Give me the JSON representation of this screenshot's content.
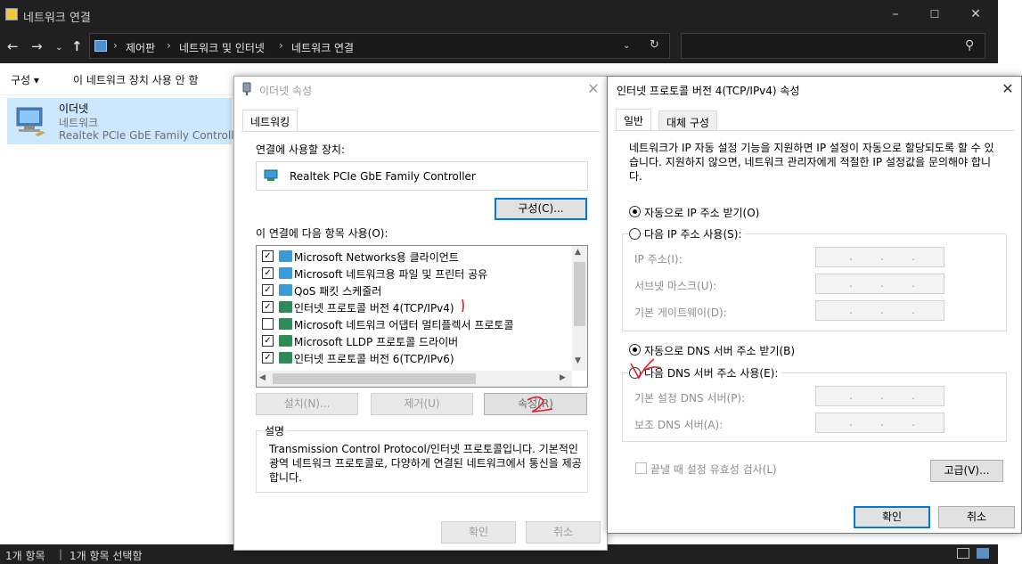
{
  "explorer": {
    "title": "네트워크 연결",
    "breadcrumbs": [
      "제어판",
      "네트워크 및 인터넷",
      "네트워크 연결"
    ],
    "commands": [
      "구성 ▾",
      "이 네트워크 장치 사용 안 함"
    ],
    "item": {
      "name": "이더넷",
      "type": "네트워크",
      "device": "Realtek PCIe GbE Family Controller"
    },
    "status": {
      "count": "1개 항목",
      "selected": "1개 항목 선택함"
    }
  },
  "ethernet_dialog": {
    "title": "이더넷 속성",
    "tab": "네트워킹",
    "connect_using_label": "연결에 사용할 장치:",
    "adapter": "Realtek PCIe GbE Family Controller",
    "configure_button": "구성(C)...",
    "items_label": "이 연결에 다음 항목 사용(O):",
    "items": [
      {
        "label": "Microsoft Networks용 클라이언트",
        "checked": true
      },
      {
        "label": "Microsoft 네트워크용 파일 및 프린터 공유",
        "checked": true
      },
      {
        "label": "QoS 패킷 스케줄러",
        "checked": true
      },
      {
        "label": "인터넷 프로토콜 버전 4(TCP/IPv4)",
        "checked": true
      },
      {
        "label": "Microsoft 네트워크 어댑터 멀티플렉서 프로토콜",
        "checked": false
      },
      {
        "label": "Microsoft LLDP 프로토콜 드라이버",
        "checked": true
      },
      {
        "label": "인터넷 프로토콜 버전 6(TCP/IPv6)",
        "checked": true
      }
    ],
    "install_button": "설치(N)...",
    "remove_button": "제거(U)",
    "properties_button": "속성(R)",
    "description_label": "설명",
    "description": "Transmission Control Protocol/인터넷 프로토콜입니다. 기본적인 광역 네트워크 프로토콜로, 다양하게 연결된 네트워크에서 통신을 제공합니다.",
    "ok_button": "확인",
    "cancel_button": "취소"
  },
  "ipv4_dialog": {
    "title": "인터넷 프로토콜 버전 4(TCP/IPv4) 속성",
    "tabs": [
      "일반",
      "대체 구성"
    ],
    "intro": "네트워크가 IP 자동 설정 기능을 지원하면 IP 설정이 자동으로 할당되도록 할 수 있습니다. 지원하지 않으면, 네트워크 관리자에게 적절한 IP 설정값을 문의해야 합니다.",
    "auto_ip": "자동으로 IP 주소 받기(O)",
    "manual_ip": "다음 IP 주소 사용(S):",
    "ip_address_label": "IP 주소(I):",
    "subnet_label": "서브넷 마스크(U):",
    "gateway_label": "기본 게이트웨이(D):",
    "auto_dns": "자동으로 DNS 서버 주소 받기(B)",
    "manual_dns": "다음 DNS 서버 주소 사용(E):",
    "preferred_dns_label": "기본 설정 DNS 서버(P):",
    "alternate_dns_label": "보조 DNS 서버(A):",
    "validate_label": "끝낼 때 설정 유효성 검사(L)",
    "advanced_button": "고급(V)...",
    "ok_button": "확인",
    "cancel_button": "취소",
    "ip_separator": "."
  },
  "annotations": {
    "mark_1": "1",
    "mark_2": "2",
    "color": "#e0202a"
  }
}
